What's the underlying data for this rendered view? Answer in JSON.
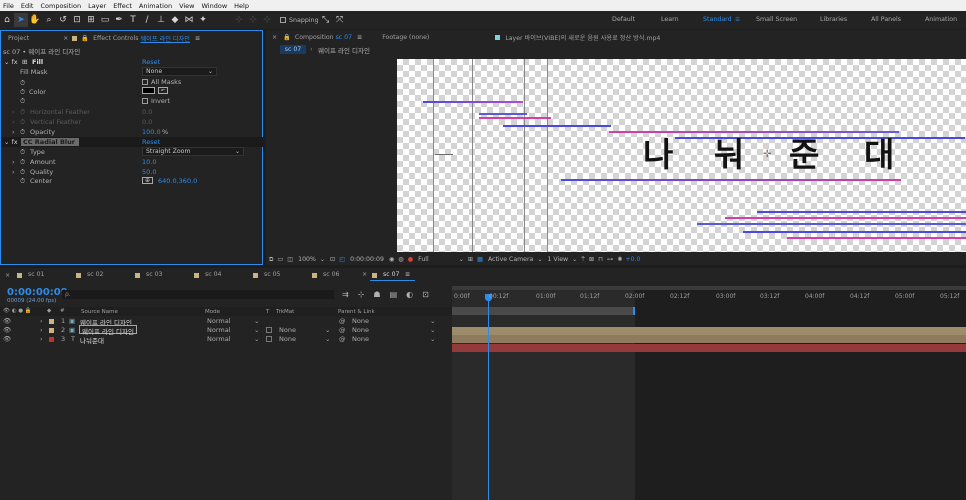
{
  "menu": [
    "File",
    "Edit",
    "Composition",
    "Layer",
    "Effect",
    "Animation",
    "View",
    "Window",
    "Help"
  ],
  "toolbar": {
    "snapping": "Snapping",
    "workspaces": [
      "Default",
      "Learn",
      "Standard",
      "Small Screen",
      "Libraries",
      "All Panels",
      "Animation"
    ],
    "active_workspace": "Standard"
  },
  "project_tabs": {
    "project": "Project",
    "effect_controls": "Effect Controls",
    "effect_layer": "웨이프 라인 디자인"
  },
  "effect_controls": {
    "header": "sc 07 • 웨이프 라인 디자인",
    "fill": {
      "name": "Fill",
      "reset": "Reset",
      "fill_mask_label": "Fill Mask",
      "fill_mask_value": "None",
      "all_masks": "All Masks",
      "color_label": "Color",
      "invert": "Invert",
      "h_feather_label": "Horizontal Feather",
      "h_feather_value": "0.0",
      "v_feather_label": "Vertical Feather",
      "v_feather_value": "0.0",
      "opacity_label": "Opacity",
      "opacity_value": "100.0",
      "opacity_unit": "%"
    },
    "radial_blur": {
      "name": "CC Radial Blur",
      "reset": "Reset",
      "type_label": "Type",
      "type_value": "Straight Zoom",
      "amount_label": "Amount",
      "amount_value": "10.0",
      "quality_label": "Quality",
      "quality_value": "50.0",
      "center_label": "Center",
      "center_value": "640.0,360.0"
    }
  },
  "comp_tabs": {
    "composition_prefix": "Composition",
    "composition_name": "sc 07",
    "footage": "Footage (none)",
    "layer": "Layer 바이브(VIBE)의 새로운 음원 사용료 정산 방식.mp4",
    "sub_tab": "sc 07",
    "breadcrumb": "웨이프 라인 디자인"
  },
  "viewer": {
    "characters": [
      "나",
      "눠",
      "준",
      "대"
    ],
    "zoom": "100%",
    "timecode": "0:00:00:09",
    "resolution": "Full",
    "camera": "Active Camera",
    "views": "1 View",
    "exposure": "+0.0"
  },
  "timeline": {
    "scenes": [
      "sc 01",
      "sc 02",
      "sc 03",
      "sc 04",
      "sc 05",
      "sc 06",
      "sc 07"
    ],
    "scene_colors": [
      "#c8b47e",
      "#c8b47e",
      "#c8b47e",
      "#c8b47e",
      "#c8b47e",
      "#c8b47e",
      "#c8b47e"
    ],
    "current_time": "0:00:00:09",
    "fps": "00009 (24.00 fps)",
    "search_placeholder": "ρ.",
    "headers": {
      "source": "Source Name",
      "mode": "Mode",
      "t": "T",
      "trkmat": "TrkMat",
      "parent": "Parent & Link"
    },
    "layers": [
      {
        "num": "1",
        "name": "웨이프 라인 디자인",
        "mode": "Normal",
        "trkmat": "",
        "parent": "None",
        "color": "#c8b47e",
        "type": "precomp"
      },
      {
        "num": "2",
        "name": "웨이프 라인 디자인",
        "mode": "Normal",
        "trkmat": "None",
        "parent": "None",
        "color": "#c8b47e",
        "type": "precomp"
      },
      {
        "num": "3",
        "name": "나눠준대",
        "mode": "Normal",
        "trkmat": "None",
        "parent": "None",
        "color": "#c83030",
        "type": "text"
      }
    ],
    "ruler": [
      "0:00f",
      "00:12f",
      "01:00f",
      "01:12f",
      "02:00f",
      "02:12f",
      "03:00f",
      "03:12f",
      "04:00f",
      "04:12f",
      "05:00f",
      "05:12f"
    ]
  },
  "colors": {
    "accent": "#2d8ceb",
    "panel": "#232323",
    "bg": "#1d1d1d"
  }
}
